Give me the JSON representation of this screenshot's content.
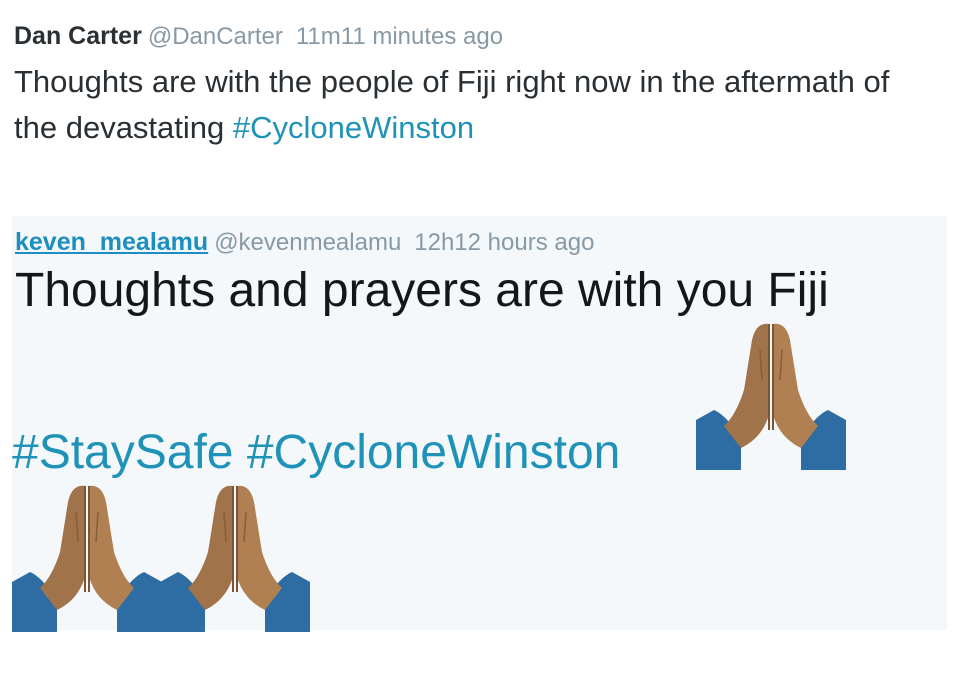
{
  "tweet1": {
    "display_name": "Dan Carter",
    "handle": "@DanCarter",
    "time": "11m11 minutes ago",
    "text_before": "Thoughts are with the people of Fiji right now in the aftermath of the devastating ",
    "hashtag": "#CycloneWinston"
  },
  "tweet2": {
    "display_name": "keven_mealamu",
    "handle": "@kevenmealamu",
    "time": "12h12 hours ago",
    "line1": "Thoughts and prayers are with you Fiji",
    "hashtag1": "#StaySafe",
    "hashtag2": "#CycloneWinston",
    "emoji_icon": "folded-hands-icon"
  },
  "colors": {
    "link": "#1f92b8",
    "name_link": "#1c8ec0",
    "meta": "#8899a6",
    "card_bg": "#f5f8fa",
    "skin": "#a0734a",
    "sleeve": "#2d6da3"
  }
}
